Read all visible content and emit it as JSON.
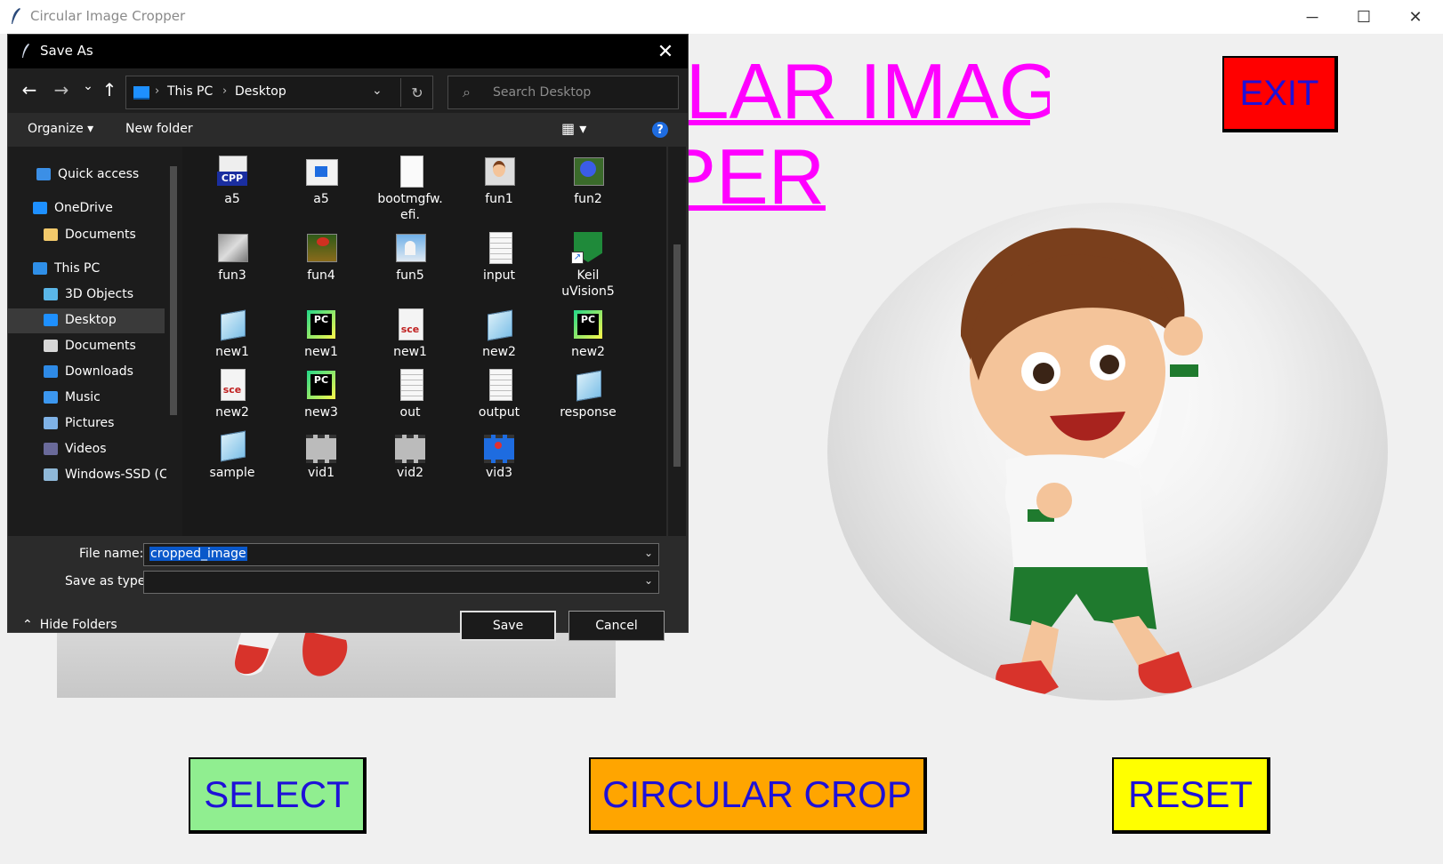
{
  "window": {
    "title": "Circular Image Cropper",
    "minimize": "─",
    "maximize": "☐",
    "close": "✕"
  },
  "app": {
    "heading_line1": "CIRCULAR IMAGE",
    "heading_line2": "CROPPER",
    "exit_label": "EXIT",
    "select_label": "SELECT",
    "crop_label": "CIRCULAR CROP",
    "reset_label": "RESET"
  },
  "dialog": {
    "title": "Save As",
    "close": "✕",
    "nav": {
      "back": "←",
      "forward": "→",
      "recent": "⌄",
      "up": "↑",
      "refresh": "↻"
    },
    "address": {
      "crumbs": [
        "This PC",
        "Desktop"
      ],
      "sep": "›",
      "dropdown": "⌄"
    },
    "search": {
      "placeholder": "Search Desktop",
      "icon": "⌕"
    },
    "toolbar": {
      "organize": "Organize ▾",
      "new_folder": "New folder",
      "view": "▦ ▾",
      "help": "?"
    },
    "nav_pane": [
      {
        "label": "Quick access",
        "icon": "star-icon",
        "color": "#3b8fe6"
      },
      {
        "label": "OneDrive",
        "icon": "cloud-icon",
        "color": "#1e90ff"
      },
      {
        "label": "Documents",
        "icon": "folder-icon",
        "color": "#f2c96b"
      },
      {
        "label": "This PC",
        "icon": "computer-icon",
        "color": "#2f8fe8"
      },
      {
        "label": "3D Objects",
        "icon": "cube-icon",
        "color": "#5ab6e8"
      },
      {
        "label": "Desktop",
        "icon": "desktop-icon",
        "color": "#1e90ff"
      },
      {
        "label": "Documents",
        "icon": "document-icon",
        "color": "#d8d8d8"
      },
      {
        "label": "Downloads",
        "icon": "download-icon",
        "color": "#2e8ae6"
      },
      {
        "label": "Music",
        "icon": "music-icon",
        "color": "#3c97ef"
      },
      {
        "label": "Pictures",
        "icon": "pictures-icon",
        "color": "#7fb2e6"
      },
      {
        "label": "Videos",
        "icon": "video-icon",
        "color": "#6a6a9a"
      },
      {
        "label": "Windows-SSD (C",
        "icon": "drive-icon",
        "color": "#8fb8d8"
      }
    ],
    "files": [
      {
        "name": "a5",
        "kind": "cpp"
      },
      {
        "name": "a5",
        "kind": "app"
      },
      {
        "name": "bootmgfw.\nefi.",
        "kind": "blank"
      },
      {
        "name": "fun1",
        "kind": "photo-boy"
      },
      {
        "name": "fun2",
        "kind": "photo-flower"
      },
      {
        "name": "fun3",
        "kind": "photo-gray"
      },
      {
        "name": "fun4",
        "kind": "photo-frog"
      },
      {
        "name": "fun5",
        "kind": "photo-taj"
      },
      {
        "name": "input",
        "kind": "text"
      },
      {
        "name": "Keil\nuVision5",
        "kind": "keil"
      },
      {
        "name": "new1",
        "kind": "notepad"
      },
      {
        "name": "new1",
        "kind": "pycharm"
      },
      {
        "name": "new1",
        "kind": "sce"
      },
      {
        "name": "new2",
        "kind": "notepad"
      },
      {
        "name": "new2",
        "kind": "pycharm"
      },
      {
        "name": "new2",
        "kind": "sce"
      },
      {
        "name": "new3",
        "kind": "pycharm"
      },
      {
        "name": "out",
        "kind": "text"
      },
      {
        "name": "output",
        "kind": "text"
      },
      {
        "name": "response",
        "kind": "notepad"
      },
      {
        "name": "sample",
        "kind": "notepad"
      },
      {
        "name": "vid1",
        "kind": "video"
      },
      {
        "name": "vid2",
        "kind": "video"
      },
      {
        "name": "vid3",
        "kind": "video-blue"
      }
    ],
    "file_name_label": "File name:",
    "file_name_value": "cropped_image",
    "save_type_label": "Save as type:",
    "save_type_value": "",
    "save_button": "Save",
    "cancel_button": "Cancel",
    "hide_folders": "Hide Folders",
    "hide_icon": "⌃"
  }
}
